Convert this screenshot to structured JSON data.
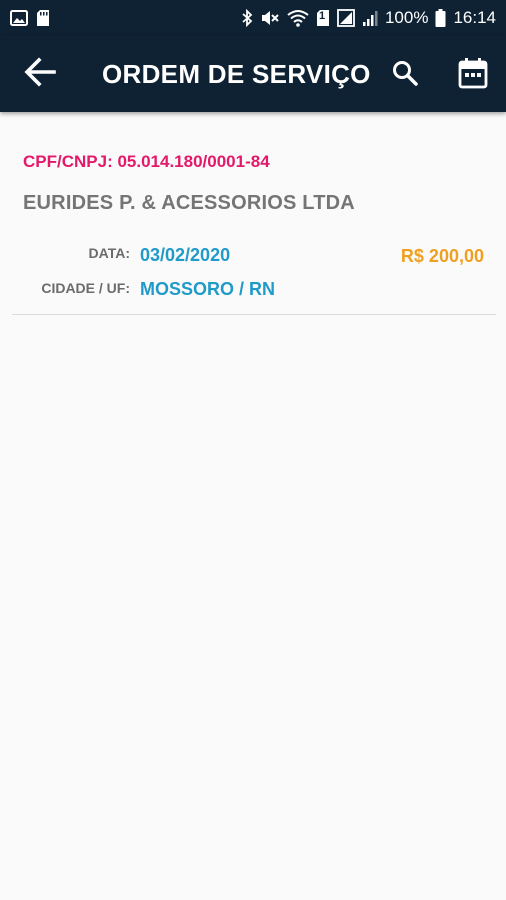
{
  "status_bar": {
    "battery": "100%",
    "time": "16:14",
    "sim_badge": "1",
    "icons": [
      "image-icon",
      "sd-card-icon",
      "bluetooth-icon",
      "mute-icon",
      "wifi-icon",
      "sim-icon",
      "signal-icon",
      "battery-icon"
    ]
  },
  "app_bar": {
    "title": "ORDEM DE SERVIÇO",
    "icons": [
      "arrow-back-icon",
      "search-icon",
      "calendar-icon"
    ],
    "color": "#0f2233"
  },
  "order": {
    "doc": "CPF/CNPJ: 05.014.180/0001-84",
    "company": "EURIDES P. & ACESSORIOS LTDA",
    "date_label": "DATA:",
    "date_value": "03/02/2020",
    "city_label": "CIDADE / UF:",
    "city_value": "MOSSORO / RN",
    "price": "R$ 200,00"
  },
  "colors": {
    "doc": "#e4196a",
    "value": "#1f9ac9",
    "price": "#f0a020",
    "company": "#757575"
  }
}
